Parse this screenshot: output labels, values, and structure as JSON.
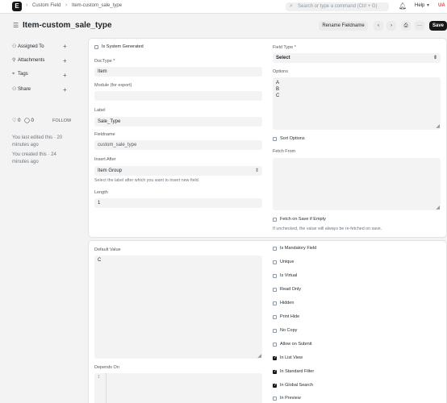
{
  "navbar": {
    "logo": "E",
    "breadcrumb": [
      "Custom Field",
      "Item-custom_sale_type"
    ],
    "search_placeholder": "Search or type a command (Ctrl + G)",
    "help_label": "Help",
    "avatar": "UA"
  },
  "page": {
    "title": "Item-custom_sale_type",
    "rename_label": "Rename Fieldname",
    "save_label": "Save"
  },
  "sidebar": {
    "items": [
      {
        "label": "Assigned To"
      },
      {
        "label": "Attachments"
      },
      {
        "label": "Tags"
      },
      {
        "label": "Share"
      }
    ],
    "likes": "0",
    "comments": "0",
    "follow_label": "FOLLOW",
    "edited_text": "You last edited this · 20 minutes ago",
    "created_text": "You created this · 24 minutes ago"
  },
  "form": {
    "is_system_generated": "Is System Generated",
    "doctype_label": "DocType *",
    "doctype_value": "Item",
    "module_label": "Module (for export)",
    "label_label": "Label",
    "label_value": "Sale_Type",
    "fieldname_label": "Fieldname",
    "fieldname_value": "custom_sale_type",
    "insert_after_label": "Insert After",
    "insert_after_value": "Item Group",
    "insert_after_desc": "Select the label after which you want to insert new field.",
    "length_label": "Length",
    "length_value": "1",
    "field_type_label": "Field Type *",
    "field_type_value": "Select",
    "options_label": "Options",
    "options_values": [
      "A",
      "B",
      "C"
    ],
    "sort_options": "Sort Options",
    "fetch_from_label": "Fetch From",
    "fetch_on_save": "Fetch on Save if Empty",
    "fetch_on_save_desc": "If unchecked, the value will always be re-fetched on save.",
    "default_value_label": "Default Value",
    "default_value": "C",
    "depends_on_label": "Depends On",
    "depends_on_line": "1",
    "checkboxes": [
      {
        "label": "Is Mandatory Field",
        "checked": false
      },
      {
        "label": "Unique",
        "checked": false
      },
      {
        "label": "Is Virtual",
        "checked": false
      },
      {
        "label": "Read Only",
        "checked": false
      },
      {
        "label": "Hidden",
        "checked": false
      },
      {
        "label": "Print Hide",
        "checked": false
      },
      {
        "label": "No Copy",
        "checked": false
      },
      {
        "label": "Allow on Submit",
        "checked": false
      },
      {
        "label": "In List View",
        "checked": true
      },
      {
        "label": "In Standard Filter",
        "checked": true
      },
      {
        "label": "In Global Search",
        "checked": true
      },
      {
        "label": "In Preview",
        "checked": false
      }
    ]
  }
}
